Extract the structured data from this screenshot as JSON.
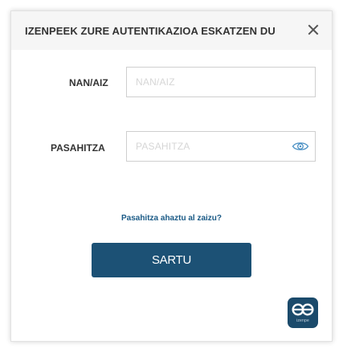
{
  "dialog": {
    "title": "IZENPEEK ZURE AUTENTIKAZIOA ESKATZEN DU",
    "close_icon": "close-icon"
  },
  "form": {
    "username": {
      "label": "NAN/AIZ",
      "placeholder": "NAN/AIZ",
      "value": ""
    },
    "password": {
      "label": "PASAHITZA",
      "placeholder": "PASAHITZA",
      "value": "",
      "toggle_icon": "eye-icon"
    },
    "forgot_link": "Pasahitza ahaztu al zaizu?",
    "submit_label": "SARTU"
  },
  "brand": {
    "logo_icon": "izenpe-logo",
    "logo_text": "izenpe"
  },
  "colors": {
    "header_bg": "#f6f6f6",
    "link": "#1a5a86",
    "button_bg": "#1c5175",
    "logo_bg": "#1b4a6b",
    "eye_icon": "#4a90c4"
  }
}
